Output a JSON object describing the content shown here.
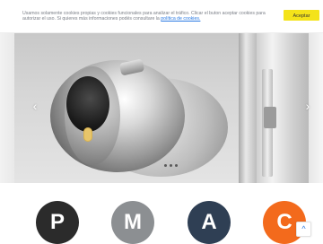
{
  "cookie_bar": {
    "text": "Usamos solamente cookies propias y cookies funcionales para analizar el tráfico. Clicar el buton aceptar cookies para autorizar el uso. Si quieres más informaciones podés consultare la ",
    "link_text": "política de cookies.",
    "accept_label": "Aceptar"
  },
  "slider": {
    "prev_icon": "chevron-left-icon",
    "next_icon": "chevron-right-icon",
    "prev_glyph": "‹",
    "next_glyph": "›",
    "dots_count": 3
  },
  "categories": [
    {
      "letter": "P",
      "color": "#2b2b2b"
    },
    {
      "letter": "M",
      "color": "#8c8f92"
    },
    {
      "letter": "A",
      "color": "#2f3f54"
    },
    {
      "letter": "C",
      "color": "#f36a1c"
    }
  ],
  "scroll_top": {
    "icon": "chevron-up-icon",
    "glyph": "^"
  }
}
